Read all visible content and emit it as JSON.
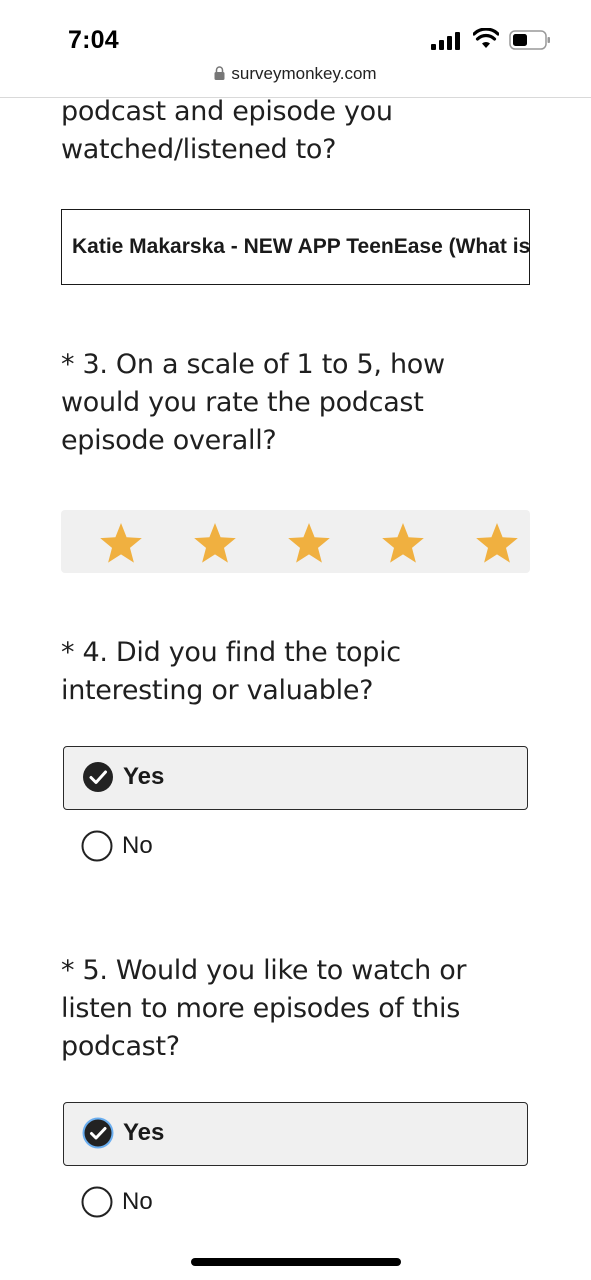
{
  "status_bar": {
    "time": "7:04",
    "icons": [
      "signal-icon",
      "wifi-icon",
      "battery-icon"
    ]
  },
  "browser": {
    "url": "surveymonkey.com",
    "lock_icon": "lock-icon"
  },
  "colors": {
    "star": "#f0b040",
    "selected_bg": "#f0f0f0",
    "text": "#1a1a1a"
  },
  "survey": {
    "q2": {
      "text_tail": "podcast and episode you watched/listened to?",
      "answer_value": "Katie Makarska - NEW APP TeenEase (What is it?)"
    },
    "q3": {
      "text": "* 3. On a scale of 1 to 5, how would you rate the podcast episode overall?",
      "rating": 5,
      "max_rating": 5
    },
    "q4": {
      "text": "* 4. Did you find the topic interesting or valuable?",
      "options": [
        {
          "label": "Yes",
          "selected": true
        },
        {
          "label": "No",
          "selected": false
        }
      ]
    },
    "q5": {
      "text": "* 5. Would you like to watch or listen to more episodes of this podcast?",
      "options": [
        {
          "label": "Yes",
          "selected": true
        },
        {
          "label": "No",
          "selected": false
        }
      ]
    }
  }
}
